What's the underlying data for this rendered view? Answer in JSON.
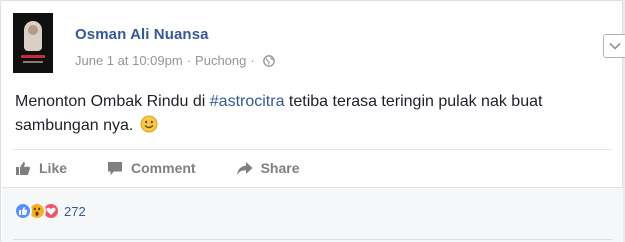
{
  "post": {
    "author": "Osman Ali Nuansa",
    "date": "June 1 at 10:09pm",
    "separator": "·",
    "location": "Puchong",
    "text_before": "Menonton Ombak Rindu di ",
    "hashtag": "#astrocitra",
    "text_after": " tetiba terasa teringin pulak nak buat sambungan nya.",
    "emoji": "smiley-emoji"
  },
  "actions": {
    "like": "Like",
    "comment": "Comment",
    "share": "Share"
  },
  "reactions": {
    "types": [
      "like",
      "wow",
      "love"
    ],
    "count": "272"
  },
  "colors": {
    "link": "#365899",
    "meta": "#90949c",
    "action": "#7f7f7f",
    "like_react": "#5890ff",
    "wow_react": "#f7b125",
    "love_react": "#f25268"
  },
  "icons": [
    "globe-icon",
    "chevron-down-icon",
    "like-icon",
    "comment-icon",
    "share-icon"
  ]
}
